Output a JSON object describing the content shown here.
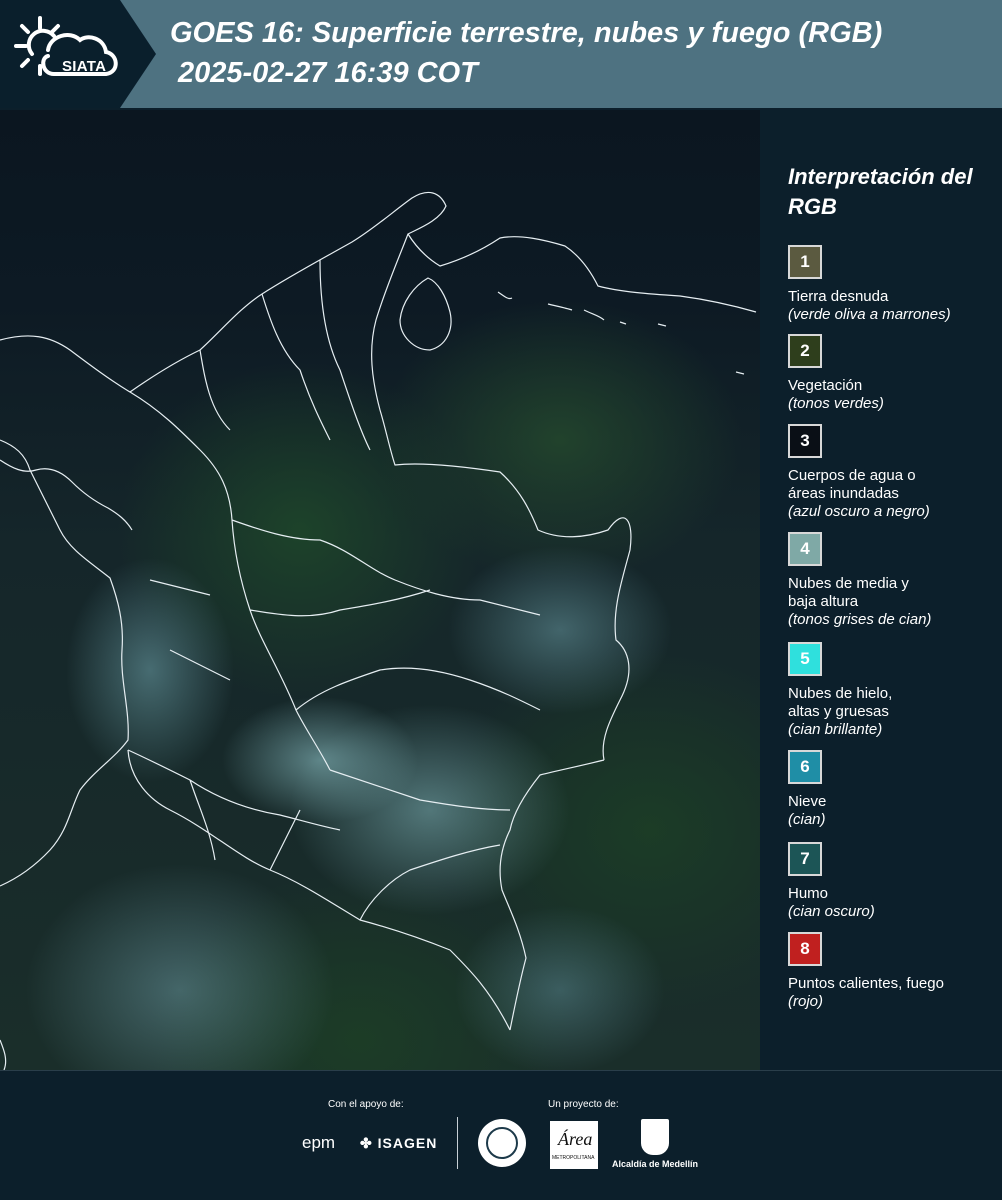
{
  "header": {
    "logo_text": "SIATA",
    "title": "GOES 16: Superficie terrestre, nubes y fuego (RGB)",
    "subtitle": "2025-02-27 16:39 COT"
  },
  "legend": {
    "title": "Interpretación del RGB",
    "items": [
      {
        "number": "1",
        "label": "Tierra desnuda",
        "description": "(verde oliva a marrones)",
        "color": "#5b5a40"
      },
      {
        "number": "2",
        "label": "Vegetación",
        "description": "(tonos verdes)",
        "color": "#2e3e1c"
      },
      {
        "number": "3",
        "label": "Cuerpos de agua o áreas inundadas",
        "label_lines": [
          "Cuerpos de agua o",
          "áreas inundadas"
        ],
        "description": "(azul oscuro a negro)",
        "color": "#0a0f16"
      },
      {
        "number": "4",
        "label": "Nubes de media y baja altura",
        "label_lines": [
          "Nubes de media y",
          "baja altura"
        ],
        "description": "(tonos grises de cian)",
        "color": "#7fa9a6"
      },
      {
        "number": "5",
        "label": "Nubes de hielo, altas y gruesas",
        "label_lines": [
          "Nubes de hielo,",
          "altas y gruesas"
        ],
        "description": "(cian brillante)",
        "color": "#2fe0dd"
      },
      {
        "number": "6",
        "label": "Nieve",
        "description": "(cian)",
        "color": "#1f8ea6"
      },
      {
        "number": "7",
        "label": "Humo",
        "description": "(cian oscuro)",
        "color": "#1c5556"
      },
      {
        "number": "8",
        "label": "Puntos calientes, fuego",
        "description": "(rojo)",
        "color": "#c0201f"
      }
    ]
  },
  "footer": {
    "support_label": "Con el apoyo de:",
    "project_label": "Un proyecto de:",
    "epm": "epm",
    "isagen": "ISAGEN",
    "area_script": "Área",
    "area_small": "METROPOLITANA",
    "alcaldia": "Alcaldía de Medellín"
  }
}
